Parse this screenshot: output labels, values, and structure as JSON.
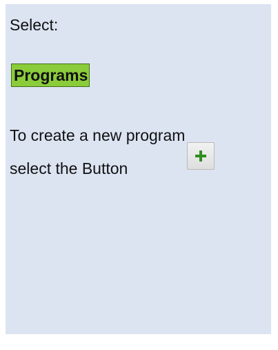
{
  "instructions": {
    "select_label": "Select:",
    "menu_item": "Programs",
    "line1": "To create a new program",
    "line2": "select the Button"
  },
  "button": {
    "icon": "plus-icon"
  },
  "colors": {
    "panel_bg": "#dce4f2",
    "highlight_bg": "#8bcc3a",
    "plus_green": "#2f8f1f"
  }
}
